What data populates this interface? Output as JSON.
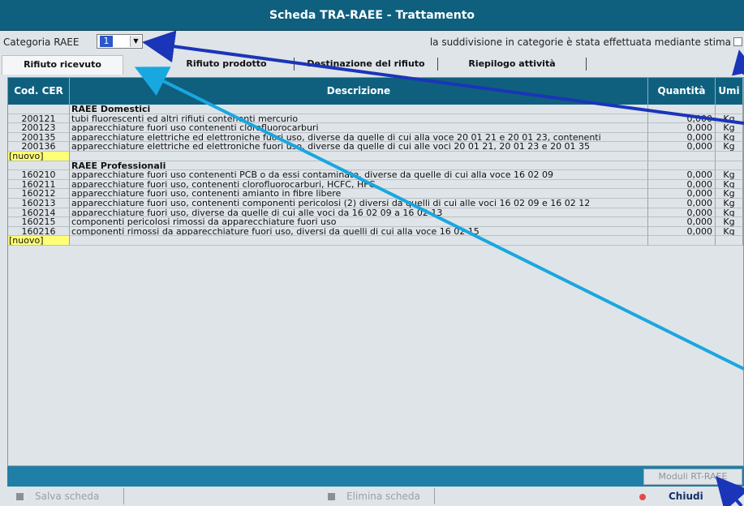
{
  "window": {
    "title": "Scheda TRA-RAEE - Trattamento"
  },
  "categoria": {
    "label": "Categoria RAEE",
    "value": "1",
    "stima_label": "la suddivisione in categorie è stata effettuata mediante stima"
  },
  "tabs": [
    {
      "label": "Rifiuto ricevuto",
      "active": true
    },
    {
      "label": "Rifiuto prodotto",
      "active": false
    },
    {
      "label": "Destinazione del rifiuto",
      "active": false
    },
    {
      "label": "Riepilogo attività",
      "active": false
    }
  ],
  "table": {
    "columns": [
      "Cod. CER",
      "Descrizione",
      "Quantità",
      "Umi"
    ],
    "groups": [
      {
        "title": "RAEE Domestici",
        "rows": [
          {
            "code": "200121",
            "desc": "tubi fluorescenti ed altri rifiuti contenenti mercurio",
            "qty": "0,000",
            "unit": "Kg"
          },
          {
            "code": "200123",
            "desc": "apparecchiature fuori uso contenenti clorofluorocarburi",
            "qty": "0,000",
            "unit": "Kg"
          },
          {
            "code": "200135",
            "desc": "apparecchiature elettriche ed elettroniche fuori uso, diverse da quelle di cui alla voce 20 01 21 e 20 01 23, contenenti",
            "qty": "0,000",
            "unit": "Kg"
          },
          {
            "code": "200136",
            "desc": "apparecchiature elettriche ed elettroniche fuori uso, diverse da quelle di cui alle voci 20 01 21, 20 01 23 e 20 01 35",
            "qty": "0,000",
            "unit": "Kg"
          }
        ],
        "new_label": "[nuovo]"
      },
      {
        "title": "RAEE Professionali",
        "rows": [
          {
            "code": "160210",
            "desc": "apparecchiature fuori uso contenenti PCB o da essi contaminate, diverse da quelle di cui alla voce 16 02 09",
            "qty": "0,000",
            "unit": "Kg"
          },
          {
            "code": "160211",
            "desc": "apparecchiature fuori uso, contenenti clorofluorocarburi, HCFC, HFC",
            "qty": "0,000",
            "unit": "Kg"
          },
          {
            "code": "160212",
            "desc": "apparecchiature fuori uso, contenenti amianto in fibre libere",
            "qty": "0,000",
            "unit": "Kg"
          },
          {
            "code": "160213",
            "desc": "apparecchiature fuori uso, contenenti componenti pericolosi (2) diversi da quelli di cui alle voci 16 02 09 e 16 02 12",
            "qty": "0,000",
            "unit": "Kg"
          },
          {
            "code": "160214",
            "desc": "apparecchiature fuori uso, diverse da quelle di cui alle voci da 16 02 09 a 16 02 13",
            "qty": "0,000",
            "unit": "Kg"
          },
          {
            "code": "160215",
            "desc": "componenti pericolosi rimossi da apparecchiature fuori uso",
            "qty": "0,000",
            "unit": "Kg"
          },
          {
            "code": "160216",
            "desc": "componenti rimossi da apparecchiature fuori uso, diversi da quelli di cui alla voce 16 02 15",
            "qty": "0,000",
            "unit": "Kg"
          }
        ],
        "new_label": "[nuovo]"
      }
    ]
  },
  "statusbar": {
    "moduli_label": "Moduli RT-RAEE"
  },
  "bottom": {
    "salva_label": "Salva scheda",
    "elimina_label": "Elimina scheda",
    "chiudi_label": "Chiudi"
  },
  "colors": {
    "header": "#0f607e",
    "statusbar": "#1f7fa6",
    "nuovo_highlight": "#ffff77",
    "arrow_dark": "#1a35b8",
    "arrow_light": "#19a7e0"
  }
}
